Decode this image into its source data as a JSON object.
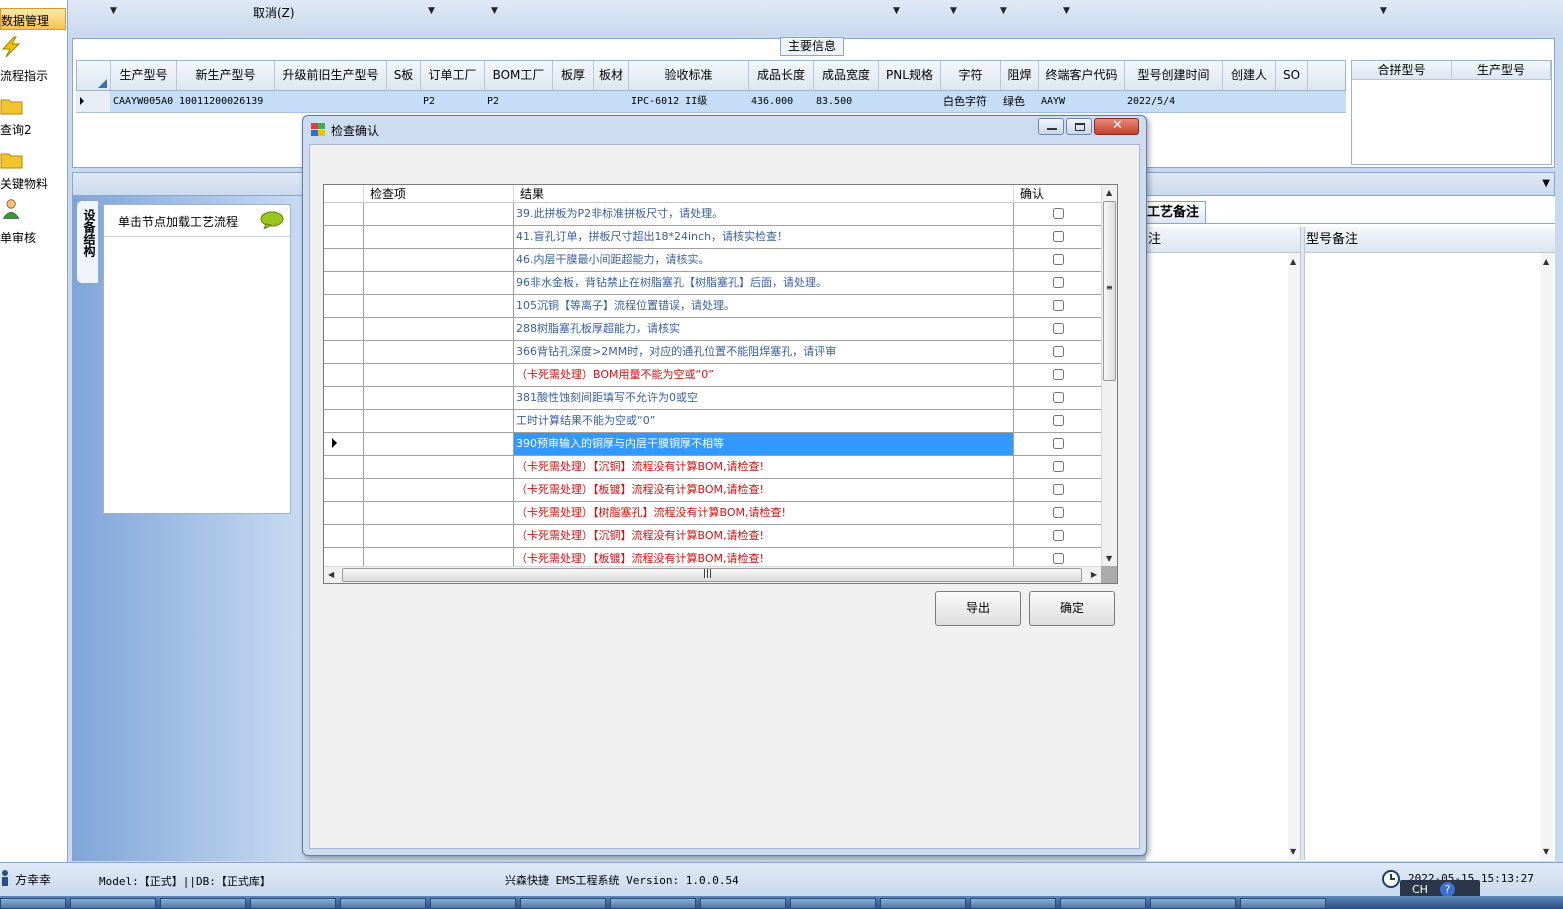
{
  "leftnav": {
    "items": [
      {
        "label": "数据管理",
        "icon": "database-icon"
      },
      {
        "label": "流程指示",
        "icon": "lightning-icon"
      },
      {
        "label": "查询2",
        "icon": "folder-icon"
      },
      {
        "label": "关键物料",
        "icon": "folder-icon"
      },
      {
        "label": "单审核",
        "icon": "user-icon"
      }
    ]
  },
  "toolbar": {
    "cancel_label": "取消(Z)"
  },
  "main_group": {
    "title": "主要信息",
    "columns": [
      "生产型号",
      "新生产型号",
      "升级前旧生产型号",
      "S板",
      "订单工厂",
      "BOM工厂",
      "板厚",
      "板材",
      "验收标准",
      "成品长度",
      "成品宽度",
      "PNL规格",
      "字符",
      "阻焊",
      "终端客户代码",
      "型号创建时间",
      "创建人",
      "SO"
    ],
    "row": [
      "CAAYW005A0",
      "10011200026139",
      "",
      "",
      "P2",
      "P2",
      "",
      "",
      "IPC-6012 II级",
      "436.000",
      "83.500",
      "",
      "白色字符",
      "绿色",
      "AAYW",
      "2022/5/4",
      "",
      ""
    ],
    "side_columns": [
      "合拼型号",
      "生产型号"
    ]
  },
  "tree": {
    "tab_label": "设备结构",
    "hint": "单击节点加载工艺流程",
    "bubble_icon": "speech-bubble-icon"
  },
  "right_pane": {
    "tab": "工艺备注",
    "col1": "注",
    "col2": "型号备注"
  },
  "dialog": {
    "title": "检查确认",
    "columns": {
      "item": "检查项",
      "result": "结果",
      "confirm": "确认"
    },
    "rows": [
      {
        "result": "39.此拼板为P2非标准拼板尺寸，请处理。",
        "color": "blue"
      },
      {
        "result": "41.盲孔订单，拼板尺寸超出18*24inch，请核实检查！",
        "color": "blue"
      },
      {
        "result": "46.内层干膜最小间距超能力，请核实。",
        "color": "blue"
      },
      {
        "result": "96非水金板，背钻禁止在树脂塞孔【树脂塞孔】后面，请处理。",
        "color": "blue"
      },
      {
        "result": "105沉铜【等离子】流程位置错误，请处理。",
        "color": "blue"
      },
      {
        "result": "288树脂塞孔板厚超能力，请核实",
        "color": "blue"
      },
      {
        "result": "366背钻孔深度>2MM时，对应的通孔位置不能阻焊塞孔，请评审",
        "color": "blue"
      },
      {
        "result": "（卡死需处理）BOM用量不能为空或“0”",
        "color": "red"
      },
      {
        "result": "381酸性蚀刻间距填写不允许为0或空",
        "color": "blue"
      },
      {
        "result": "工时计算结果不能为空或“0”",
        "color": "blue"
      },
      {
        "result": "390预审输入的铜厚与内层干膜铜厚不相等",
        "color": "blue",
        "selected": true
      },
      {
        "result": "（卡死需处理）【沉铜】流程没有计算BOM,请检查!",
        "color": "red"
      },
      {
        "result": "（卡死需处理）【板镀】流程没有计算BOM,请检查!",
        "color": "red"
      },
      {
        "result": "（卡死需处理）【树脂塞孔】流程没有计算BOM,请检查!",
        "color": "red"
      },
      {
        "result": "（卡死需处理）【沉铜】流程没有计算BOM,请检查!",
        "color": "red"
      },
      {
        "result": "（卡死需处理）【板镀】流程没有计算BOM,请检查!",
        "color": "red"
      }
    ],
    "export_label": "导出",
    "ok_label": "确定"
  },
  "status": {
    "user": "方幸幸",
    "model_db": "Model:【正式】||DB:【正式库】",
    "app": "兴森快捷 EMS工程系统 Version: 1.0.0.54",
    "time": "2022-05-15 15:13:27",
    "ime": "CH"
  },
  "colors": {
    "selection": "#3399ff",
    "blue_text": "#3a5fa0",
    "red_text": "#d01010",
    "row_highlight": "#c5ddf7"
  }
}
